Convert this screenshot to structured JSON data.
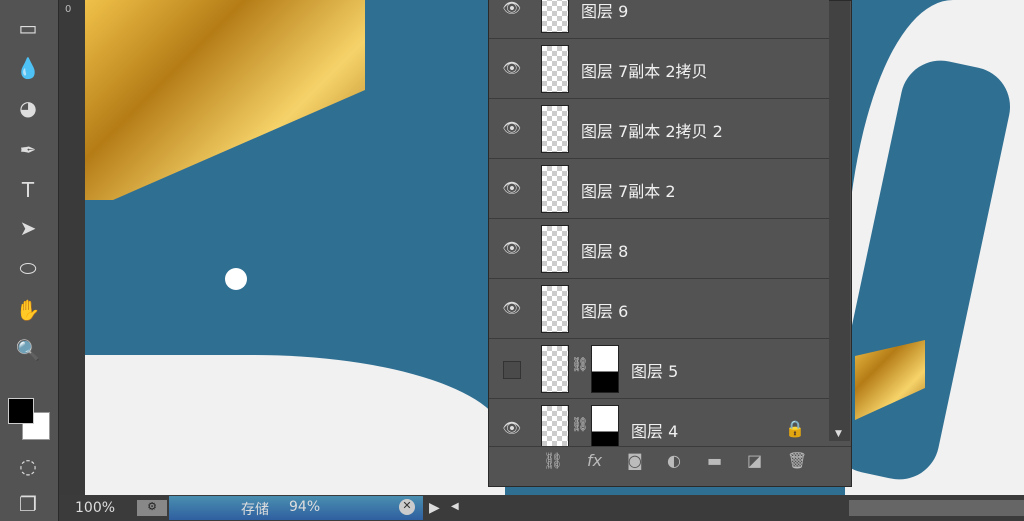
{
  "tools": [
    {
      "icon": "rectangle-marquee-icon"
    },
    {
      "icon": "blur-drop-icon"
    },
    {
      "icon": "dodge-icon"
    },
    {
      "icon": "pen-icon"
    },
    {
      "icon": "type-icon",
      "label": "T"
    },
    {
      "icon": "path-selection-icon"
    },
    {
      "icon": "ellipse-icon"
    },
    {
      "icon": "hand-icon"
    },
    {
      "icon": "zoom-icon"
    }
  ],
  "ruler": {
    "mark": "0"
  },
  "layers": [
    {
      "name": "图层 9",
      "visible": true
    },
    {
      "name": "图层 7副本 2拷贝",
      "visible": true
    },
    {
      "name": "图层 7副本 2拷贝 2",
      "visible": true
    },
    {
      "name": "图层 7副本 2",
      "visible": true
    },
    {
      "name": "图层 8",
      "visible": true
    },
    {
      "name": "图层 6",
      "visible": true
    },
    {
      "name": "图层 5",
      "visible": false,
      "mask": true
    },
    {
      "name": "图层 4",
      "visible": true,
      "mask": true,
      "locked": true
    }
  ],
  "footer_icons": [
    "link-icon",
    "fx-icon",
    "mask-icon",
    "adjustment-icon",
    "folder-icon",
    "new-layer-icon",
    "trash-icon"
  ],
  "status": {
    "zoom": "100%",
    "progress_label": "存储",
    "progress_value": "94%",
    "progress": 94
  }
}
